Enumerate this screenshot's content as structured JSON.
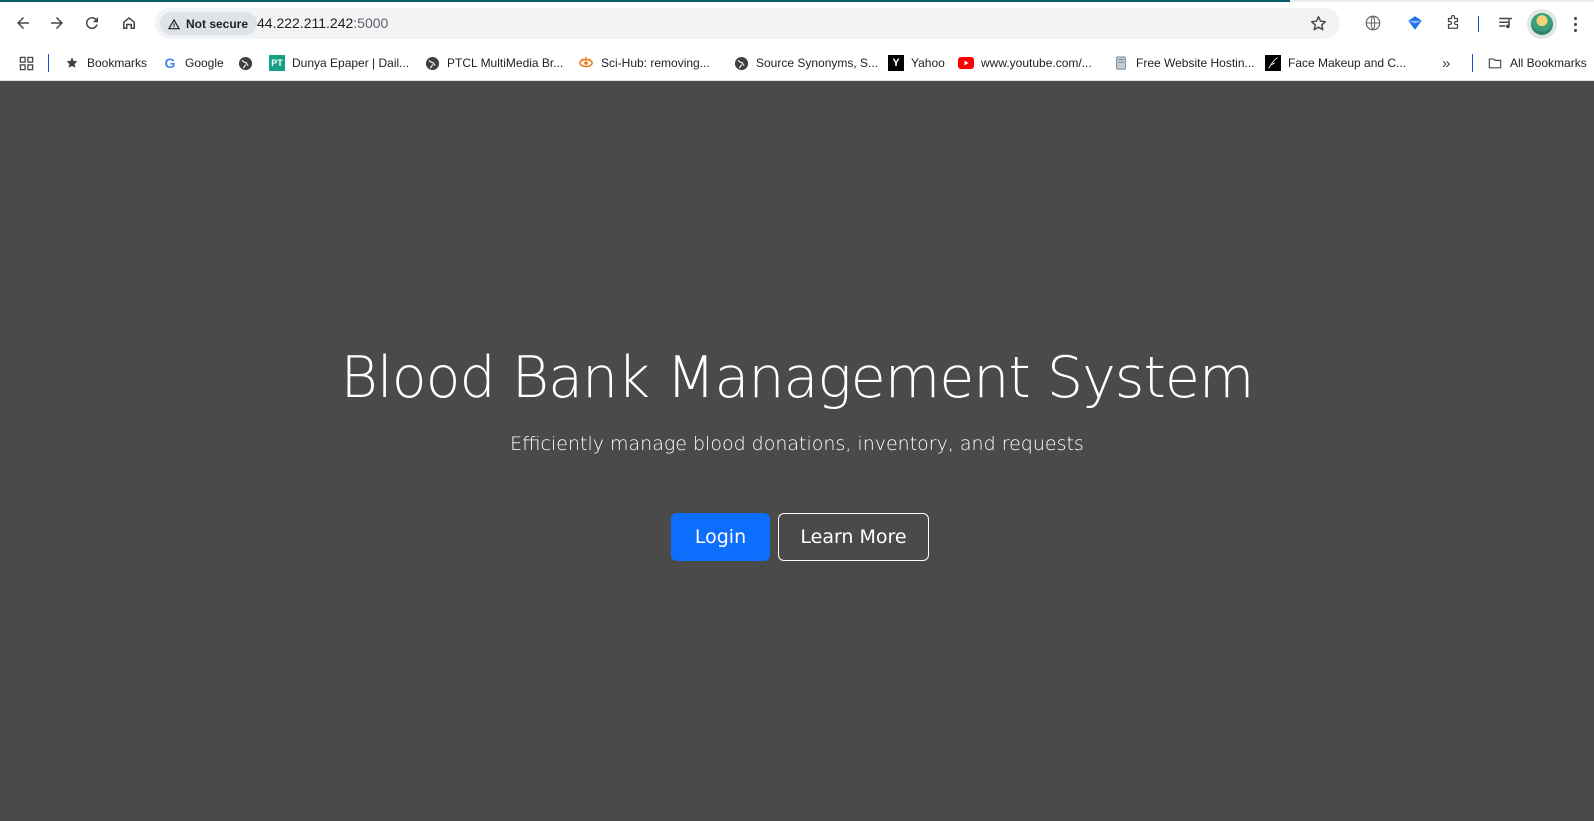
{
  "browser": {
    "security_label": "Not secure",
    "url_host": "44.222.211.242",
    "url_port": ":5000",
    "icons": {
      "back": "back-arrow-icon",
      "forward": "forward-arrow-icon",
      "reload": "reload-icon",
      "home": "home-icon",
      "warning": "warning-triangle-icon",
      "star": "star-icon",
      "translate": "globe-icon",
      "extension_blue": "diamond-extension-icon",
      "extensions": "puzzle-icon",
      "reading_list": "media-queue-icon",
      "profile": "avatar",
      "menu": "three-dot-menu-icon"
    }
  },
  "bookmarks_bar": {
    "items": [
      {
        "label": "Bookmarks",
        "icon": "star-icon"
      },
      {
        "label": "Google",
        "icon": "google-icon"
      },
      {
        "label": "",
        "icon": "globe-icon"
      },
      {
        "label": "Dunya Epaper | Dail...",
        "icon": "pt-icon"
      },
      {
        "label": "PTCL MultiMedia Br...",
        "icon": "globe-icon"
      },
      {
        "label": "Sci-Hub: removing...",
        "icon": "eye-icon"
      },
      {
        "label": "Source Synonyms, S...",
        "icon": "globe-icon"
      },
      {
        "label": "Yahoo",
        "icon": "yahoo-icon"
      },
      {
        "label": "www.youtube.com/...",
        "icon": "youtube-icon"
      },
      {
        "label": "Free Website Hostin...",
        "icon": "server-icon"
      },
      {
        "label": "Face Makeup and C...",
        "icon": "face-icon"
      }
    ],
    "overflow": "»",
    "all_bookmarks": "All Bookmarks",
    "apps_icon": "apps-grid-icon"
  },
  "hero": {
    "title": "Blood Bank Management System",
    "subtitle": "Efficiently manage blood donations, inventory, and requests",
    "login_label": "Login",
    "learn_more_label": "Learn More"
  },
  "colors": {
    "page_background": "#4a4a4a",
    "primary_button": "#0d6efd",
    "text": "#ffffff"
  }
}
